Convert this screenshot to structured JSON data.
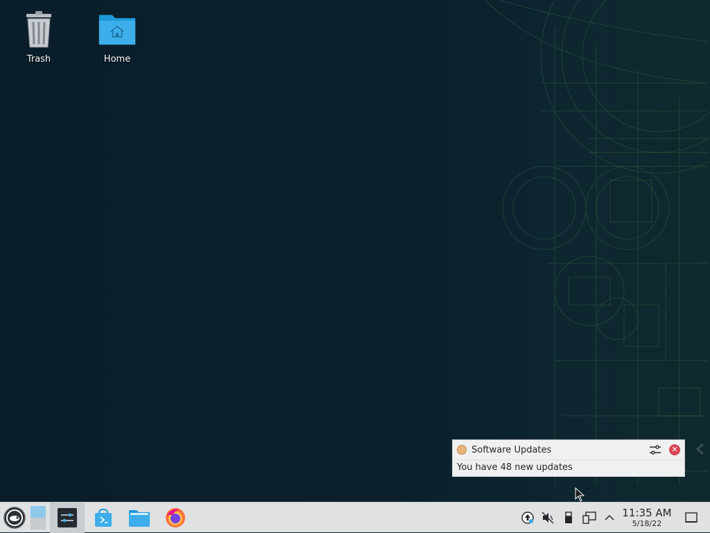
{
  "desktop": {
    "icons": [
      {
        "label": "Trash",
        "icon": "trash-icon"
      },
      {
        "label": "Home",
        "icon": "home-folder-icon"
      }
    ]
  },
  "notification": {
    "app_icon": "software-updates-icon",
    "title": "Software Updates",
    "message": "You have 48 new updates",
    "close_icon": "close-icon",
    "config_icon": "configure-icon"
  },
  "taskbar": {
    "launcher_icon": "opensuse-launcher-icon",
    "items": [
      {
        "icon": "pager-icon"
      },
      {
        "icon": "system-settings-icon"
      },
      {
        "icon": "discover-store-icon"
      },
      {
        "icon": "file-manager-icon"
      },
      {
        "icon": "firefox-icon"
      }
    ],
    "tray": [
      {
        "icon": "updates-icon"
      },
      {
        "icon": "volume-muted-icon"
      },
      {
        "icon": "usb-device-icon"
      },
      {
        "icon": "network-icon"
      },
      {
        "icon": "tray-expand-icon"
      }
    ],
    "clock": {
      "time": "11:35 AM",
      "date": "5/18/22"
    },
    "show_desktop_icon": "show-desktop-icon"
  },
  "colors": {
    "desktop_bg": "#0a1e2b",
    "taskbar_bg": "#dfe1e3",
    "notification_bg": "#eff0f1",
    "close_red": "#da4453",
    "folder_blue": "#3daee9"
  }
}
